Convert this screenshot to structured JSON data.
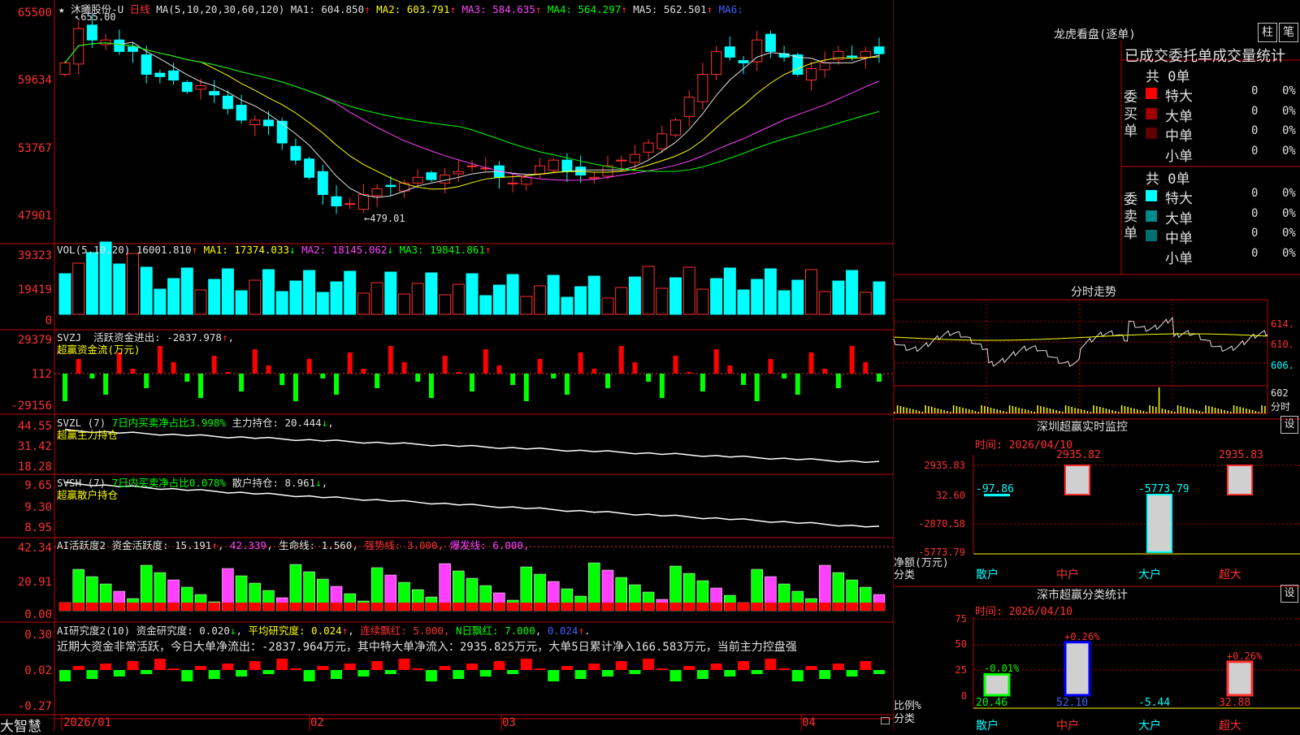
{
  "stock": {
    "star": "★",
    "name": "沐曦股份-U",
    "period": "日线",
    "ma_label": "MA(5,10,20,30,60,120)",
    "ma1": "MA1: 604.850",
    "ma2": "MA2: 603.791",
    "ma3": "MA3: 584.635",
    "ma4": "MA4: 564.297",
    "ma5": "MA5: 562.501",
    "ma6": "MA6:",
    "arrow_up": "↑",
    "arrow_down": "↓",
    "high_mark": "655.00",
    "low_mark": "479.01",
    "price_ticks": [
      "65500",
      "59634",
      "53767",
      "47901"
    ]
  },
  "vol": {
    "label": "VOL(5,10,20)",
    "v": "16001.810",
    "ma1": "MA1: 17374.033",
    "ma2": "MA2: 18145.062",
    "ma3": "MA3: 19841.861",
    "ticks": [
      "39323",
      "19419",
      "0"
    ]
  },
  "svzj": {
    "label": "SVZJ",
    "desc": "活跃资金进出: -2837.978",
    "sub": "超赢资金流(万元)",
    "ticks": [
      "29379",
      "112",
      "-29156"
    ]
  },
  "svzl": {
    "label": "SVZL (7)",
    "desc": "7日内买卖净占比3.998%",
    "hold": "主力持仓: 20.444",
    "sub": "超赢主力持仓",
    "ticks": [
      "44.55",
      "31.42",
      "18.28"
    ]
  },
  "svsh": {
    "label": "SVSH (7)",
    "desc": "7日内买卖净占比0.078%",
    "hold": "散户持仓: 8.961",
    "sub": "超赢散户持仓",
    "ticks": [
      "9.65",
      "9.30",
      "8.95"
    ]
  },
  "ai1": {
    "label": "AI活跃度2",
    "a": "资金活跃度: 15.191",
    "b": "42.339",
    "c": "生命线: 1.560",
    "d": "强势线: 3.000",
    "e": "爆发线: 6.000",
    "ticks": [
      "42.34",
      "20.91",
      "0.00"
    ]
  },
  "ai2": {
    "label": "AI研究度2(10)",
    "a": "资金研究度: 0.020",
    "b": "平均研究度: 0.024",
    "c": "连续飘红: 5.000",
    "d": "N日飘红: 7.000",
    "e": "0.024",
    "note": "近期大资金非常活跃，今日大单净流出：-2837.964万元，其中特大单净流入：2935.825万元，大单5日累计净入166.583万元，当前主力控盘强",
    "ticks": [
      "0.30",
      "0.02",
      "-0.27"
    ]
  },
  "xaxis": {
    "logo": "大智慧",
    "labels": [
      "2026/01",
      "02",
      "03",
      "04"
    ]
  },
  "rp1": {
    "title": "龙虎看盘(逐单)",
    "btn1": "柱",
    "btn2": "笔",
    "subtitle": "已成交委托单成交量统计",
    "buy": {
      "side": "委买单",
      "total": "共 0单",
      "rows": [
        {
          "n": "特大",
          "v": "0",
          "p": "0%",
          "c": "#ff0000"
        },
        {
          "n": "大单",
          "v": "0",
          "p": "0%",
          "c": "#a00000"
        },
        {
          "n": "中单",
          "v": "0",
          "p": "0%",
          "c": "#600000"
        },
        {
          "n": "小单",
          "v": "0",
          "p": "0%",
          "c": "#000000"
        }
      ]
    },
    "sell": {
      "side": "委卖单",
      "total": "共 0单",
      "rows": [
        {
          "n": "特大",
          "v": "0",
          "p": "0%",
          "c": "#00ffff"
        },
        {
          "n": "大单",
          "v": "0",
          "p": "0%",
          "c": "#008b8b"
        },
        {
          "n": "中单",
          "v": "0",
          "p": "0%",
          "c": "#007070"
        },
        {
          "n": "小单",
          "v": "0",
          "p": "0%",
          "c": "#000000"
        }
      ]
    }
  },
  "rp2": {
    "title": "分时走势",
    "ticks": [
      "614.",
      "610.",
      "606.",
      "602",
      "分时"
    ]
  },
  "rp3": {
    "title": "深圳超赢实时监控",
    "btn": "设",
    "time": "时间: 2026/04/10",
    "ticks": [
      "2935.83",
      "32.60",
      "-2870.58",
      "-5773.79"
    ],
    "ylabel": "净额(万元)",
    "xlabel": "分类",
    "cats": [
      "散户",
      "中户",
      "大户",
      "超大"
    ],
    "values": [
      "-97.86",
      "2935.82",
      "-5773.79",
      "2935.83"
    ],
    "nums": [
      -97.86,
      2935.82,
      -5773.79,
      2935.83
    ]
  },
  "rp4": {
    "title": "深市超赢分类统计",
    "btn": "设",
    "time": "时间: 2026/04/10",
    "ticks": [
      "75",
      "50",
      "25",
      "0"
    ],
    "ylabel": "比例%",
    "xlabel": "分类",
    "cats": [
      "散户",
      "中户",
      "大户",
      "超大"
    ],
    "pcts": [
      "-0.01%",
      "+0.26%",
      "",
      "+0.26%"
    ],
    "vals": [
      "20.46",
      "52.10",
      "-5.44",
      "32.88"
    ],
    "nums": [
      20.46,
      52.1,
      -5.44,
      32.88
    ]
  }
}
